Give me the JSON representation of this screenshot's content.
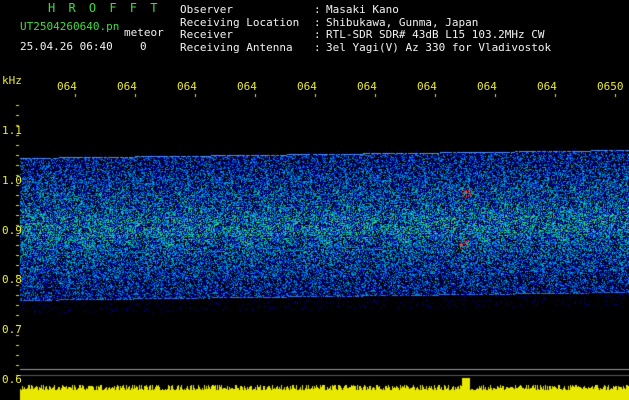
{
  "header": {
    "title": "H R O F F T",
    "filename": "UT2504260640.pn",
    "mode": "meteor",
    "datetime": "25.04.26 06:40",
    "count": "0",
    "fields": [
      {
        "label": "Observer",
        "value": "Masaki Kano"
      },
      {
        "label": "Receiving Location",
        "value": "Shibukawa, Gunma, Japan"
      },
      {
        "label": "Receiver",
        "value": "RTL-SDR SDR# 43dB L15 103.2MHz CW"
      },
      {
        "label": "Receiving Antenna",
        "value": "3el Yagi(V) Az 330 for Vladivostok"
      }
    ]
  },
  "time_axis": {
    "labels": [
      "064",
      "064",
      "064",
      "064",
      "064",
      "064",
      "064",
      "064",
      "064",
      "0650"
    ]
  },
  "freq_axis": {
    "unit": "kHz",
    "labels": [
      "1.1",
      "1.0",
      "0.9",
      "0.8",
      "0.7",
      "0.6"
    ]
  },
  "colors": {
    "green_text": "#3fdc3f",
    "yellow_text": "#e8e830",
    "baseline": "#e8e800"
  }
}
